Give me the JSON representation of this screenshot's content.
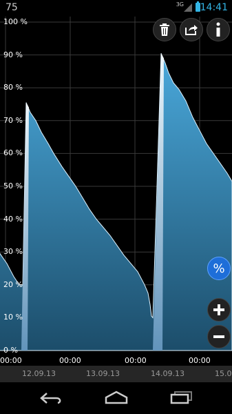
{
  "status_bar": {
    "left_value": "75",
    "network": "3G",
    "time": "14:41"
  },
  "chart_data": {
    "type": "area",
    "ylim": [
      0,
      100
    ],
    "y_tick_labels": [
      "100 %",
      "90 %",
      "80 %",
      "70 %",
      "60 %",
      "50 %",
      "40 %",
      "30 %",
      "20 %",
      "10 %",
      "0 %"
    ],
    "x_time_labels": [
      "00:00",
      "00:00",
      "00:00",
      "00:00"
    ],
    "x_date_labels": [
      "12.09.13",
      "13.09.13",
      "14.09.13",
      "15.0"
    ],
    "series": [
      {
        "values": [
          [
            -2,
            31
          ],
          [
            0,
            29.5
          ],
          [
            10,
            26.5
          ],
          [
            20,
            22.5
          ],
          [
            28,
            20
          ],
          [
            33,
            20
          ],
          [
            38,
            75.5
          ],
          [
            44,
            72.5
          ],
          [
            52,
            70
          ],
          [
            60,
            66.5
          ],
          [
            70,
            63
          ],
          [
            78,
            60
          ],
          [
            90,
            56
          ],
          [
            100,
            53
          ],
          [
            110,
            50
          ],
          [
            120,
            46.5
          ],
          [
            130,
            43
          ],
          [
            140,
            40
          ],
          [
            150,
            37.5
          ],
          [
            160,
            35
          ],
          [
            170,
            32
          ],
          [
            180,
            29
          ],
          [
            190,
            26.5
          ],
          [
            200,
            24
          ],
          [
            210,
            20
          ],
          [
            215,
            17.5
          ],
          [
            218,
            14
          ],
          [
            220,
            10.5
          ],
          [
            222,
            10
          ],
          [
            228,
            50
          ],
          [
            234,
            90.5
          ],
          [
            240,
            87.5
          ],
          [
            245,
            84.5
          ],
          [
            252,
            81.5
          ],
          [
            260,
            79.5
          ],
          [
            270,
            76
          ],
          [
            280,
            71
          ],
          [
            290,
            67
          ],
          [
            300,
            63
          ],
          [
            310,
            60
          ],
          [
            320,
            57
          ],
          [
            330,
            54
          ],
          [
            337,
            51.5
          ]
        ]
      }
    ]
  },
  "toolbar": {
    "icons": [
      "trash-icon",
      "share-icon",
      "info-icon"
    ]
  },
  "side_controls": {
    "percent_label": "%",
    "zoom_in_icon": "plus-icon",
    "zoom_out_icon": "minus-icon"
  },
  "nav_bar": {
    "icons": [
      "back-icon",
      "home-icon",
      "recents-icon"
    ]
  },
  "colors": {
    "accent": "#33b5e5",
    "area_top": "#4aa9dc",
    "area_bottom": "#1c4d6a",
    "percent_button": "#1e6ed8",
    "grid": "#3a3a3a"
  }
}
